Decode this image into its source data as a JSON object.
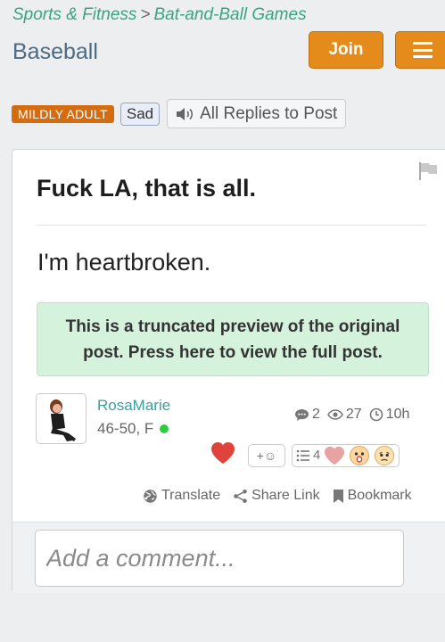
{
  "breadcrumb": {
    "category": "Sports & Fitness",
    "separator": ">",
    "subcategory": "Bat-and-Ball Games"
  },
  "group": {
    "title": "Baseball",
    "join_label": "Join"
  },
  "tags": {
    "rating": "MILDLY ADULT",
    "mood": "Sad",
    "replies_label": "All Replies to Post"
  },
  "post": {
    "title": "Fuck LA, that is all.",
    "body": "I'm heartbroken.",
    "preview_note": "This is a truncated preview of the original post. Press here to view the full post."
  },
  "author": {
    "name": "RosaMarie",
    "info": "46-50, F",
    "online": true
  },
  "stats": {
    "comments": "2",
    "views": "27",
    "age": "10h"
  },
  "reactions": {
    "add_label": "+☺",
    "count": "4"
  },
  "actions": {
    "translate": "Translate",
    "share": "Share Link",
    "bookmark": "Bookmark"
  },
  "comment": {
    "placeholder": "Add a comment..."
  },
  "colors": {
    "accent": "#e58b1c",
    "link": "#3aa37f",
    "title": "#4d6a83",
    "badge": "#d46d12",
    "preview_bg": "#d5f2dd"
  }
}
